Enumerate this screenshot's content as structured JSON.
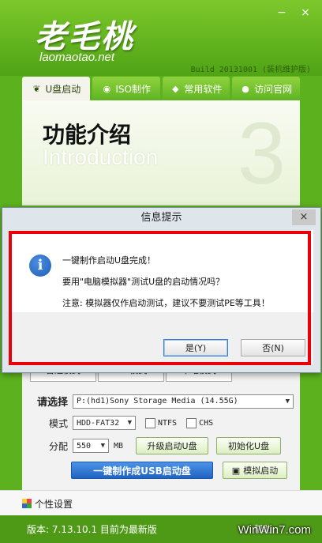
{
  "header": {
    "logo_cn": "老毛桃",
    "logo_url": "laomaotao.net",
    "build": "Build 20131001 (装机维护版)",
    "window_buttons": [
      "−",
      "×"
    ]
  },
  "tabs": [
    {
      "label": "U盘启动",
      "icon": "leaf-icon",
      "active": true
    },
    {
      "label": "ISO制作",
      "icon": "disc-icon",
      "active": false
    },
    {
      "label": "常用软件",
      "icon": "box-icon",
      "active": false
    },
    {
      "label": "访问官网",
      "icon": "person-icon",
      "active": false
    }
  ],
  "panel": {
    "title_cn": "功能介绍",
    "title_en": "Introduction",
    "step_number": "3"
  },
  "dialog": {
    "title": "信息提示",
    "close": "×",
    "line1": "一键制作启动U盘完成！",
    "line2": "要用\"电脑模拟器\"测试U盘的启动情况吗？",
    "line3": "注意: 模拟器仅作启动测试，建议不要测试PE等工具！",
    "yes_label": "是(Y)",
    "no_label": "否(N)",
    "highlight_color": "#e8000b"
  },
  "modes": [
    "普通模式",
    "ISO模式",
    "本地模式"
  ],
  "form": {
    "select_label": "请选择",
    "device": "P:(hd1)Sony Storage Media (14.55G)",
    "mode_label": "模式",
    "mode_value": "HDD-FAT32",
    "ntfs_label": "NTFS",
    "chs_label": "CHS",
    "partition_label": "分配",
    "partition_value": "550",
    "partition_unit": "MB",
    "upgrade_button": "升级启动U盘",
    "init_button": "初始化U盘",
    "make_button": "一键制作成USB启动盘",
    "simulate_button": "模拟启动"
  },
  "settings_label": "个性设置",
  "status": {
    "version": "版本: 7.13.10.1  目前为最新版",
    "help": "帮助"
  },
  "watermark": "WinWin7.com"
}
